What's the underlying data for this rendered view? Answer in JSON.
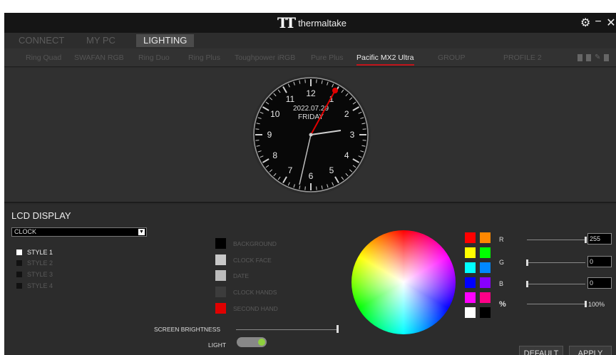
{
  "window": {
    "brand": "thermaltake"
  },
  "main_tabs": [
    {
      "label": "CONNECT",
      "active": false
    },
    {
      "label": "MY PC",
      "active": false
    },
    {
      "label": "LIGHTING",
      "active": true
    }
  ],
  "device_tabs": [
    {
      "label": "Ring Quad"
    },
    {
      "label": "SWAFAN RGB"
    },
    {
      "label": "Ring Duo"
    },
    {
      "label": "Ring Plus"
    },
    {
      "label": "Toughpower iRGB"
    },
    {
      "label": "Pure Plus"
    },
    {
      "label": "Pacific MX2 Ultra",
      "active": true
    },
    {
      "label": "GROUP"
    },
    {
      "label": "PROFILE 2"
    }
  ],
  "clock": {
    "date": "2022.07.29",
    "day": "FRIDAY",
    "numerals": [
      "12",
      "1",
      "2",
      "3",
      "4",
      "5",
      "6",
      "7",
      "8",
      "9",
      "10",
      "11"
    ]
  },
  "lcd": {
    "title": "LCD DISPLAY",
    "mode": "CLOCK",
    "styles": [
      {
        "label": "STYLE 1",
        "active": true
      },
      {
        "label": "STYLE 2",
        "active": false
      },
      {
        "label": "STYLE 3",
        "active": false
      },
      {
        "label": "STYLE 4",
        "active": false
      }
    ],
    "properties": [
      {
        "label": "BACKGROUND",
        "color": "#000000"
      },
      {
        "label": "CLOCK FACE",
        "color": "#c8c8c8"
      },
      {
        "label": "DATE",
        "color": "#bcbcbc"
      },
      {
        "label": "CLOCK HANDS",
        "color": "#3c3c3c"
      },
      {
        "label": "SECOND HAND",
        "color": "#e00000"
      }
    ],
    "screen_brightness_label": "SCREEN BRIGHTNESS",
    "screen_brightness": 1.0,
    "light_label": "LIGHT",
    "light_on": true
  },
  "palette": [
    "#ff0000",
    "#ff8800",
    "#ffff00",
    "#00ff00",
    "#00ffff",
    "#0088ff",
    "#0000ff",
    "#8800ff",
    "#ff00ff",
    "#ff0088",
    "#ffffff",
    "#000000"
  ],
  "channels": {
    "r": {
      "label": "R",
      "value": "255",
      "level": 1.0
    },
    "g": {
      "label": "G",
      "value": "0",
      "level": 0.0
    },
    "b": {
      "label": "B",
      "value": "0",
      "level": 0.0
    },
    "percent": {
      "label": "%",
      "value": "100%",
      "level": 1.0
    }
  },
  "buttons": {
    "default": "DEFAULT",
    "apply": "APPLY"
  },
  "colors": {
    "accent": "#c0141a",
    "toggle_on": "#8fd13e"
  }
}
